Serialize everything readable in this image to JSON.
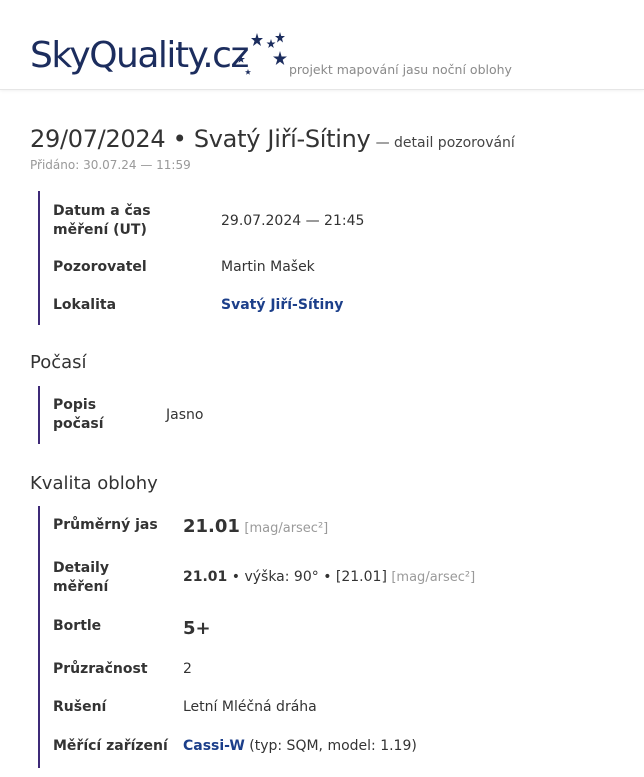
{
  "header": {
    "logo_text": "SkyQuality.cz",
    "tagline": "projekt mapování jasu noční oblohy",
    "colors": {
      "logo": "#1c2d5e",
      "accent": "#3e2a78"
    }
  },
  "observation": {
    "title": "29/07/2024 • Svatý Jiří-Sítiny",
    "title_suffix": "— detail pozorování",
    "added": "Přidáno: 30.07.24 — 11:59",
    "details": [
      {
        "label": "Datum a čas měření (UT)",
        "value": "29.07.2024 — 21:45"
      },
      {
        "label": "Pozorovatel",
        "value": "Martin Mašek"
      },
      {
        "label": "Lokalita",
        "value": "Svatý Jiří-Sítiny"
      }
    ]
  },
  "weather": {
    "heading": "Počasí",
    "description_label": "Popis počasí",
    "description_value": "Jasno"
  },
  "sky": {
    "heading": "Kvalita oblohy",
    "avg_label": "Průměrný jas",
    "avg_value": "21.01",
    "avg_unit": "[mag/arsec²]",
    "details_label": "Detaily měření",
    "details_value": "21.01",
    "details_extra": "• výška: 90° • [21.01]",
    "details_unit": "[mag/arsec²]",
    "bortle_label": "Bortle",
    "bortle_value": "5+",
    "transparency_label": "Průzračnost",
    "transparency_value": "2",
    "disturbance_label": "Rušení",
    "disturbance_value": "Letní Mléčná dráha",
    "device_label": "Měřící zařízení",
    "device_name": "Cassi-W",
    "device_info": "(typ: SQM, model: 1.19)"
  }
}
